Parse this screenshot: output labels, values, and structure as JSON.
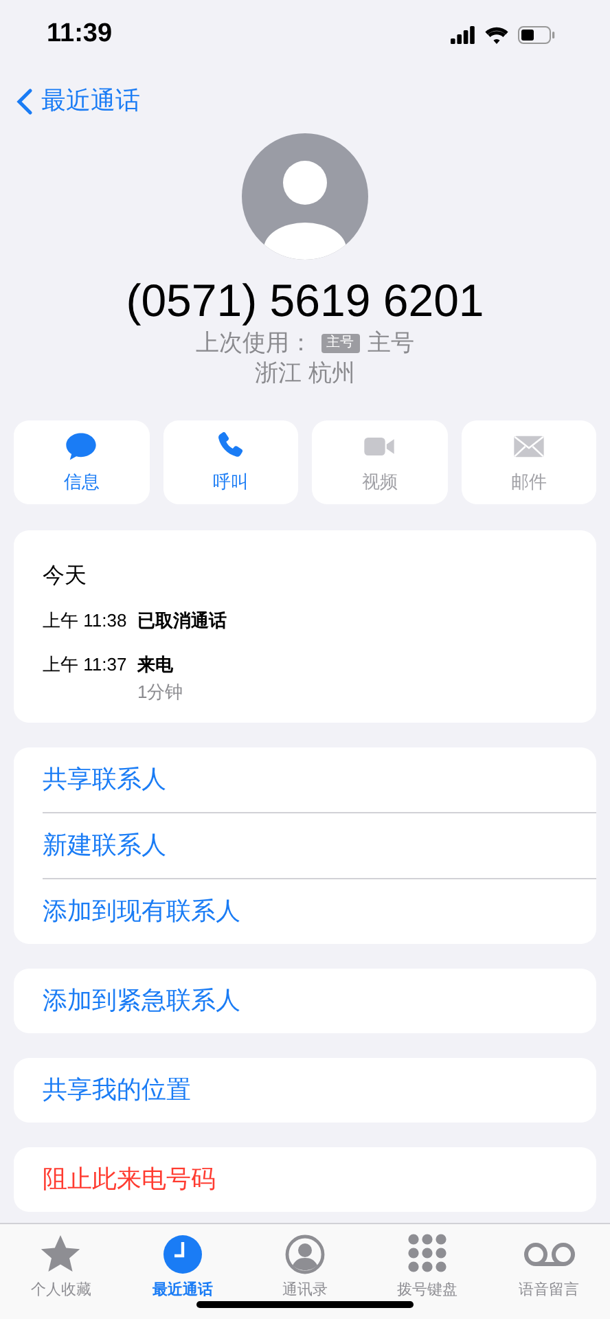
{
  "status_bar": {
    "time": "11:39"
  },
  "nav": {
    "back_label": "最近通话"
  },
  "contact": {
    "number": "(0571) 5619 6201",
    "last_used_label": "上次使用：",
    "line_badge": "主号",
    "line_name": "主号",
    "location": "浙江 杭州"
  },
  "actions": [
    {
      "kind": "message",
      "label": "信息",
      "disabled": false
    },
    {
      "kind": "call",
      "label": "呼叫",
      "disabled": false
    },
    {
      "kind": "video",
      "label": "视频",
      "disabled": true
    },
    {
      "kind": "mail",
      "label": "邮件",
      "disabled": true
    }
  ],
  "call_log": {
    "date": "今天",
    "entries": [
      {
        "time": "上午 11:38",
        "type": "已取消通话"
      },
      {
        "time": "上午 11:37",
        "type": "来电",
        "duration": "1分钟"
      }
    ]
  },
  "option_groups": [
    [
      {
        "label": "共享联系人",
        "destructive": false
      },
      {
        "label": "新建联系人",
        "destructive": false
      },
      {
        "label": "添加到现有联系人",
        "destructive": false
      }
    ],
    [
      {
        "label": "添加到紧急联系人",
        "destructive": false
      }
    ],
    [
      {
        "label": "共享我的位置",
        "destructive": false
      }
    ],
    [
      {
        "label": "阻止此来电号码",
        "destructive": true
      }
    ]
  ],
  "tab_bar": [
    {
      "kind": "favorites",
      "label": "个人收藏",
      "selected": false
    },
    {
      "kind": "recents",
      "label": "最近通话",
      "selected": true
    },
    {
      "kind": "contacts",
      "label": "通讯录",
      "selected": false
    },
    {
      "kind": "keypad",
      "label": "拨号键盘",
      "selected": false
    },
    {
      "kind": "voicemail",
      "label": "语音留言",
      "selected": false
    }
  ]
}
